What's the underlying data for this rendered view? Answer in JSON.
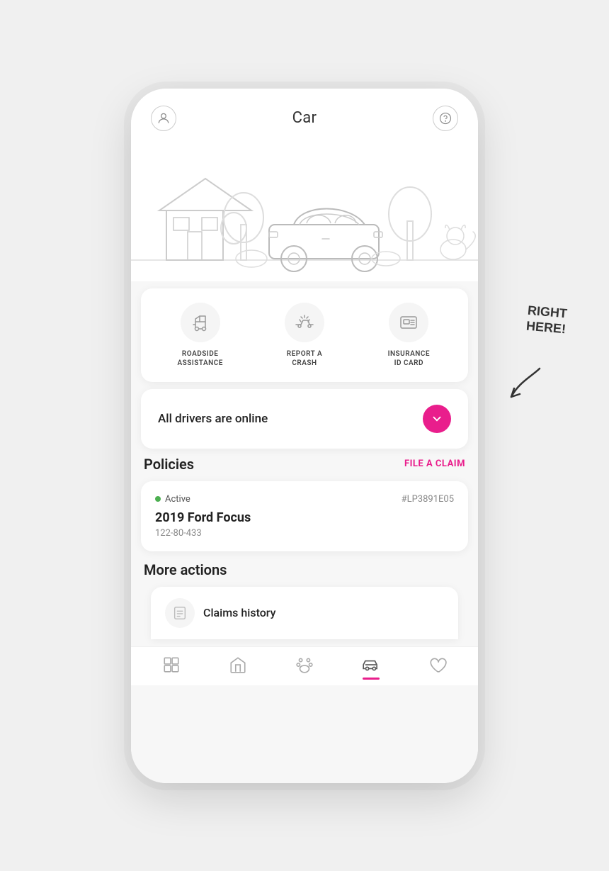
{
  "header": {
    "title": "Car",
    "profile_icon": "person-icon",
    "help_icon": "question-icon"
  },
  "quick_actions": [
    {
      "id": "roadside",
      "label": "ROADSIDE\nASSISTANCE",
      "icon": "roadside-icon"
    },
    {
      "id": "crash",
      "label": "REPORT A\nCRASH",
      "icon": "crash-icon"
    },
    {
      "id": "insurance",
      "label": "INSURANCE\nID CARD",
      "icon": "insurance-icon"
    }
  ],
  "drivers_status": {
    "text": "All drivers are online"
  },
  "policies": {
    "title": "Policies",
    "file_claim_label": "FILE A CLAIM",
    "policy": {
      "status": "Active",
      "number": "#LP3891E05",
      "car_name": "2019 Ford Focus",
      "policy_id": "122-80-433"
    }
  },
  "more_actions": {
    "title": "More actions"
  },
  "bottom_nav": [
    {
      "id": "property",
      "label": "property",
      "active": false
    },
    {
      "id": "home",
      "label": "home",
      "active": false
    },
    {
      "id": "pet",
      "label": "pet",
      "active": false
    },
    {
      "id": "car",
      "label": "car",
      "active": true
    },
    {
      "id": "life",
      "label": "life",
      "active": false
    }
  ],
  "annotation": {
    "text": "RIGHT\nHERE!",
    "arrow": "↙"
  },
  "claims": {
    "label": "Claims history"
  }
}
